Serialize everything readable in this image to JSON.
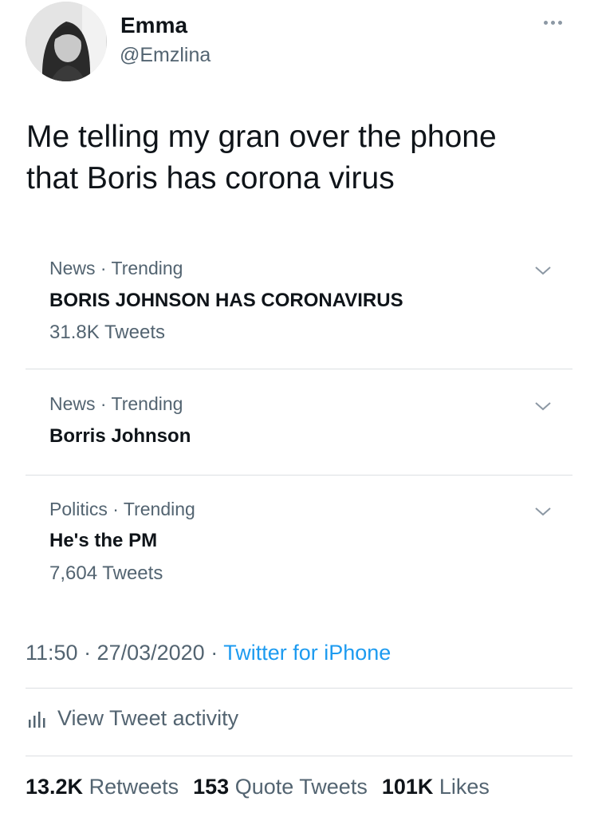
{
  "author": {
    "name": "Emma",
    "handle": "@Emzlina"
  },
  "tweet": {
    "text": "Me telling my gran over the phone\nthat Boris has corona virus"
  },
  "trends": [
    {
      "meta": "News · Trending",
      "title": "BORIS JOHNSON HAS CORONAVIRUS",
      "count": "31.8K Tweets"
    },
    {
      "meta": "News · Trending",
      "title": "Borris Johnson",
      "count": ""
    },
    {
      "meta": "Politics · Trending",
      "title": "He's the PM",
      "count": "7,604 Tweets"
    }
  ],
  "footer": {
    "time": "11:50 · 27/03/2020 · ",
    "source": "Twitter for iPhone",
    "activity": "View Tweet activity"
  },
  "stats": {
    "retweets_value": "13.2K",
    "retweets_label": "Retweets",
    "quotes_value": "153",
    "quotes_label": "Quote Tweets",
    "likes_value": "101K",
    "likes_label": "Likes"
  },
  "colors": {
    "accent": "#1d9bf0",
    "secondary_text": "#536471",
    "primary_text": "#0f1419",
    "divider": "#dcdfe2"
  },
  "icons": {
    "more": "more-horizontal-icon",
    "chevron": "chevron-down-icon",
    "activity": "bar-chart-icon"
  }
}
